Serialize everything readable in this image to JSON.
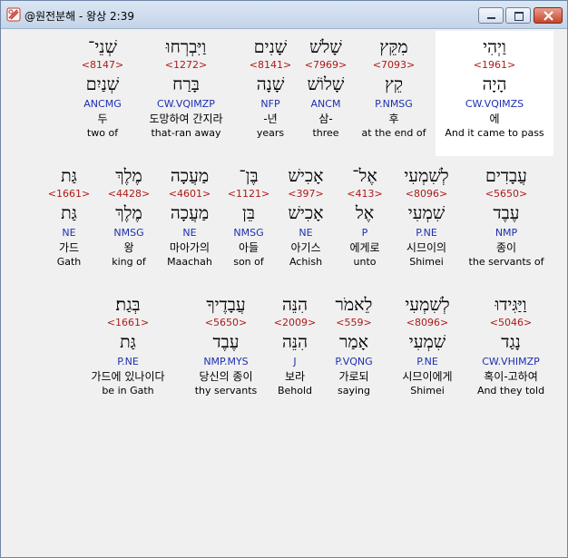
{
  "window": {
    "title": "@원전분해 - 왕상 2:39"
  },
  "verse": {
    "rows": [
      {
        "words": [
          {
            "heb": "וַיְהִי",
            "strong": "<1961>",
            "root": "הָיָה",
            "morph": "CW.VQIMZS",
            "kor": "에",
            "eng": "And it came to pass",
            "highlight": true
          },
          {
            "heb": "מִקֵּץ",
            "strong": "<7093>",
            "root": "קֵץ",
            "morph": "P.NMSG",
            "kor": "후",
            "eng": "at the end of"
          },
          {
            "heb": "שָׁלֹשׁ",
            "strong": "<7969>",
            "root": "שָׁלוֹשׁ",
            "morph": "ANCM",
            "kor": "삼-",
            "eng": "three"
          },
          {
            "heb": "שָׁנִים",
            "strong": "<8141>",
            "root": "שָׁנָה",
            "morph": "NFP",
            "kor": "-년",
            "eng": "years"
          },
          {
            "heb": "וַיִּבְרְחוּ",
            "strong": "<1272>",
            "root": "בָּרַח",
            "morph": "CW.VQIMZP",
            "kor": "도망하여 간지라",
            "eng": "that-ran away"
          },
          {
            "heb": "שְׁנֵי־",
            "strong": "<8147>",
            "root": "שְׁנַיִם",
            "morph": "ANCMG",
            "kor": "두",
            "eng": "two of"
          }
        ]
      },
      {
        "words": [
          {
            "heb": "עֲבָדִים",
            "strong": "<5650>",
            "root": "עֶבֶד",
            "morph": "NMP",
            "kor": "종이",
            "eng": "the servants of"
          },
          {
            "heb": "לְשִׁמְעִי",
            "strong": "<8096>",
            "root": "שִׁמְעִי",
            "morph": "P.NE",
            "kor": "시므이의",
            "eng": "Shimei"
          },
          {
            "heb": "אֶל־",
            "strong": "<413>",
            "root": "אֶל",
            "morph": "P",
            "kor": "에게로",
            "eng": "unto"
          },
          {
            "heb": "אָכִישׁ",
            "strong": "<397>",
            "root": "אָכִישׁ",
            "morph": "NE",
            "kor": "아기스",
            "eng": "Achish"
          },
          {
            "heb": "בֶּן־",
            "strong": "<1121>",
            "root": "בֵּן",
            "morph": "NMSG",
            "kor": "아들",
            "eng": "son of"
          },
          {
            "heb": "מַעֲכָה",
            "strong": "<4601>",
            "root": "מַעֲכָה",
            "morph": "NE",
            "kor": "마아가의",
            "eng": "Maachah"
          },
          {
            "heb": "מֶלֶךְ",
            "strong": "<4428>",
            "root": "מֶלֶךְ",
            "morph": "NMSG",
            "kor": "왕",
            "eng": "king of"
          },
          {
            "heb": "גַּת",
            "strong": "<1661>",
            "root": "גַּת",
            "morph": "NE",
            "kor": "가드",
            "eng": "Gath"
          }
        ]
      },
      {
        "words": [
          {
            "heb": "וַיַּגִּידוּ",
            "strong": "<5046>",
            "root": "נָגַד",
            "morph": "CW.VHIMZP",
            "kor": "혹이-고하여",
            "eng": "And they told"
          },
          {
            "heb": "לְשִׁמְעִי",
            "strong": "<8096>",
            "root": "שִׁמְעִי",
            "morph": "P.NE",
            "kor": "시므이에게",
            "eng": "Shimei"
          },
          {
            "heb": "לֵאמֹר",
            "strong": "<559>",
            "root": "אָמַר",
            "morph": "P.VQNG",
            "kor": "가로되",
            "eng": "saying"
          },
          {
            "heb": "הִנֵּה",
            "strong": "<2009>",
            "root": "הִנֵּה",
            "morph": "J",
            "kor": "보라",
            "eng": "Behold"
          },
          {
            "heb": "עֲבָדֶיךָ",
            "strong": "<5650>",
            "root": "עֶבֶד",
            "morph": "NMP.MYS",
            "kor": "당신의 종이",
            "eng": "thy servants"
          },
          {
            "heb": "בְּגַת׃",
            "strong": "<1661>",
            "root": "גַּת",
            "morph": "P.NE",
            "kor": "가드에 있나이다",
            "eng": "be in Gath"
          }
        ]
      }
    ]
  },
  "colors": {
    "strong": "#b01818",
    "morph": "#1c2fb0",
    "highlight_bg": "#ffffff"
  }
}
